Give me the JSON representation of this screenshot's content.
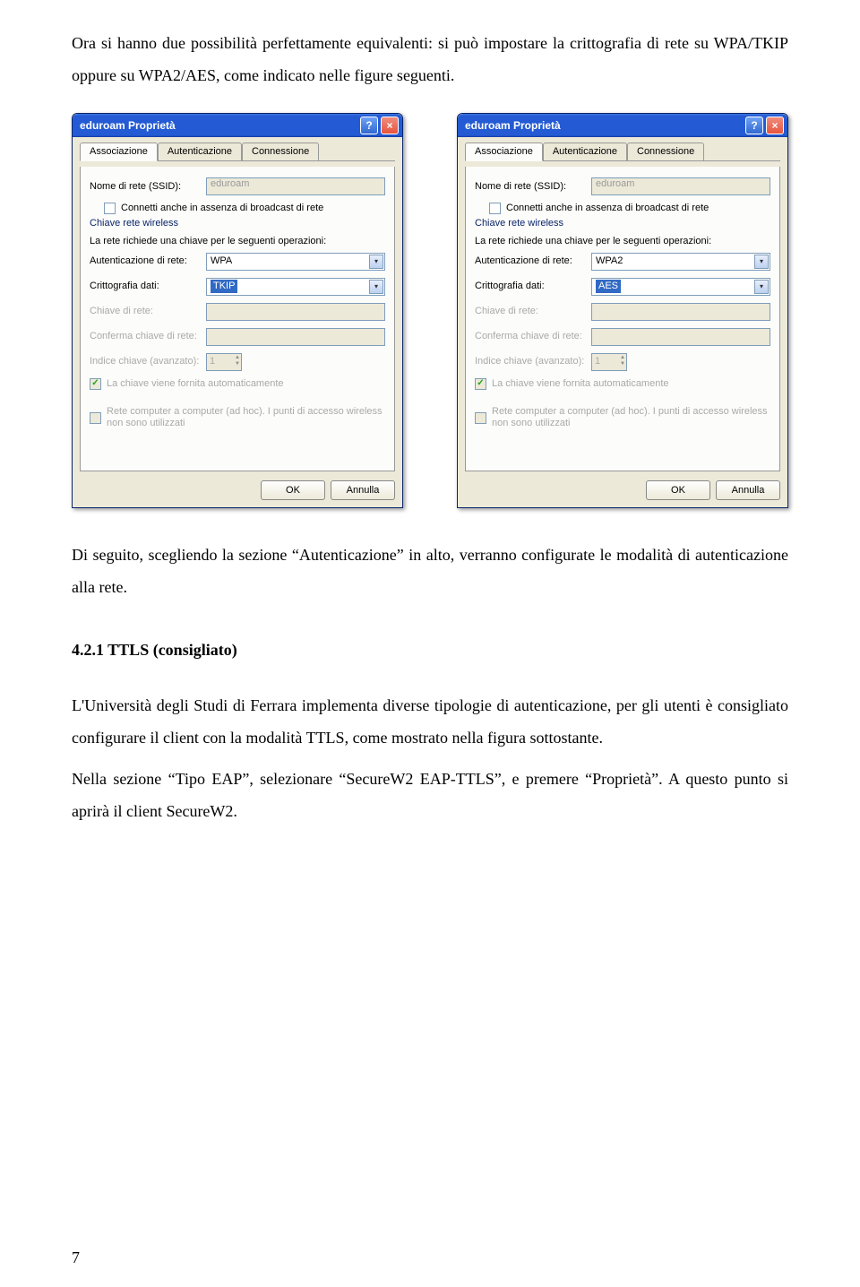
{
  "intro_text": "Ora si hanno due possibilità perfettamente equivalenti: si può impostare la crittografia di rete su WPA/TKIP oppure su WPA2/AES, come indicato nelle figure seguenti.",
  "dialogs": {
    "common": {
      "title": "eduroam Proprietà",
      "tabs": {
        "assoc": "Associazione",
        "auth": "Autenticazione",
        "conn": "Connessione"
      },
      "ssid_label": "Nome di rete (SSID):",
      "ssid_value": "eduroam",
      "chk_broadcast": "Connetti anche in assenza di broadcast di rete",
      "group_key": "Chiave rete wireless",
      "key_subtext": "La rete richiede una chiave per le seguenti operazioni:",
      "auth_label": "Autenticazione di rete:",
      "crypt_label": "Crittografia dati:",
      "netkey_label": "Chiave di rete:",
      "confirm_label": "Conferma chiave di rete:",
      "index_label": "Indice chiave (avanzato):",
      "index_val": "1",
      "chk_auto": "La chiave viene fornita automaticamente",
      "chk_adhoc": "Rete computer a computer (ad hoc). I punti di accesso wireless non sono utilizzati",
      "ok": "OK",
      "cancel": "Annulla"
    },
    "left": {
      "auth_value": "WPA",
      "crypt_value": "TKIP"
    },
    "right": {
      "auth_value": "WPA2",
      "crypt_value": "AES"
    }
  },
  "mid_text": "Di seguito, scegliendo la sezione “Autenticazione” in alto, verranno configurate le modalità di autenticazione alla rete.",
  "section_heading": "4.2.1 TTLS (consigliato)",
  "body_text_1": "L'Università degli Studi di Ferrara implementa diverse tipologie di autenticazione, per gli utenti è consigliato configurare il client con la modalità TTLS, come mostrato nella figura sottostante.",
  "body_text_2": "Nella sezione “Tipo EAP”, selezionare “SecureW2 EAP-TTLS”, e premere “Proprietà”. A questo punto si aprirà il client SecureW2.",
  "page_number": "7"
}
